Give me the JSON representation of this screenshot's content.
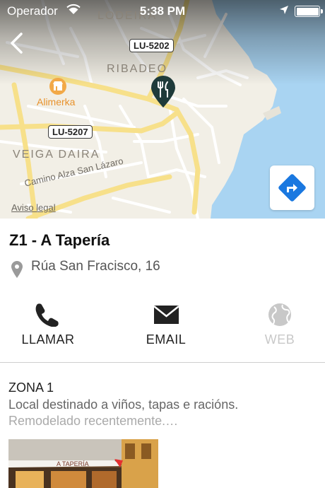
{
  "status_bar": {
    "carrier": "Operador",
    "time": "5:38 PM"
  },
  "map": {
    "labels": {
      "lodeira": "LODEIRA",
      "ribadeo": "RIBADEO",
      "veiga_daira": "VEIGA DAIRA",
      "camino": "Camino Alza San Lázaro",
      "alimerka": "Alimerka"
    },
    "road_signs": {
      "lu5202": "LU-5202",
      "lu5207": "LU-5207"
    },
    "legal_link": "Aviso legal",
    "colors": {
      "water": "#a9d4f2",
      "land": "#f2efe6",
      "road": "#f7e08a",
      "pin": "#1f3b3a"
    }
  },
  "place": {
    "name": "Z1 - A Tapería",
    "address": "Rúa San Fracisco, 16"
  },
  "actions": [
    {
      "label": "LLAMAR",
      "icon": "phone-icon",
      "enabled": true
    },
    {
      "label": "EMAIL",
      "icon": "envelope-icon",
      "enabled": true
    },
    {
      "label": "WEB",
      "icon": "globe-icon",
      "enabled": false
    }
  ],
  "detail": {
    "zone": "ZONA 1",
    "description_line1": "Local destinado a viños, tapas e racións.",
    "description_line2": "Remodelado recentemente.…",
    "photo_sign": "A TAPERÍA"
  }
}
